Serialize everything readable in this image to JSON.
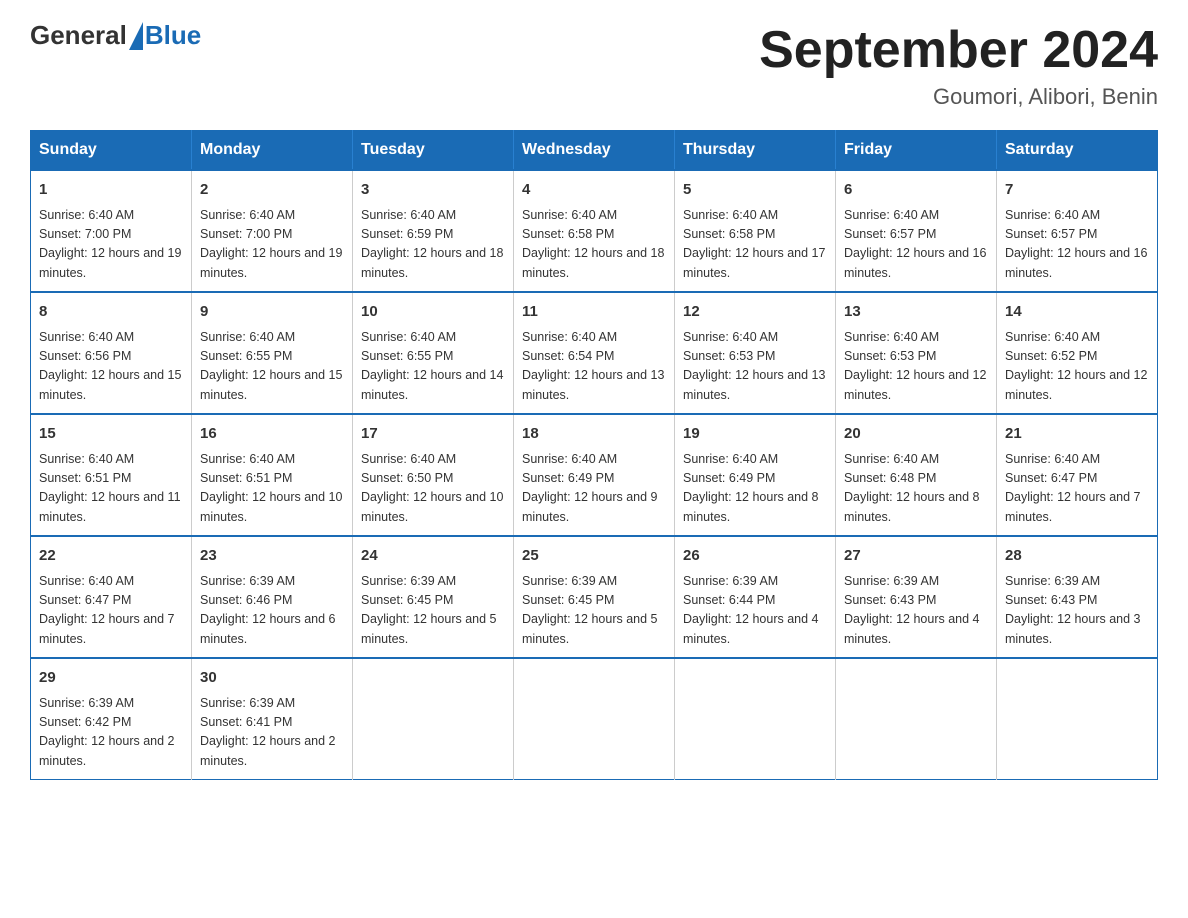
{
  "header": {
    "logo_general": "General",
    "logo_blue": "Blue",
    "main_title": "September 2024",
    "subtitle": "Goumori, Alibori, Benin"
  },
  "calendar": {
    "days_of_week": [
      "Sunday",
      "Monday",
      "Tuesday",
      "Wednesday",
      "Thursday",
      "Friday",
      "Saturday"
    ],
    "weeks": [
      [
        {
          "day": "1",
          "sunrise": "Sunrise: 6:40 AM",
          "sunset": "Sunset: 7:00 PM",
          "daylight": "Daylight: 12 hours and 19 minutes."
        },
        {
          "day": "2",
          "sunrise": "Sunrise: 6:40 AM",
          "sunset": "Sunset: 7:00 PM",
          "daylight": "Daylight: 12 hours and 19 minutes."
        },
        {
          "day": "3",
          "sunrise": "Sunrise: 6:40 AM",
          "sunset": "Sunset: 6:59 PM",
          "daylight": "Daylight: 12 hours and 18 minutes."
        },
        {
          "day": "4",
          "sunrise": "Sunrise: 6:40 AM",
          "sunset": "Sunset: 6:58 PM",
          "daylight": "Daylight: 12 hours and 18 minutes."
        },
        {
          "day": "5",
          "sunrise": "Sunrise: 6:40 AM",
          "sunset": "Sunset: 6:58 PM",
          "daylight": "Daylight: 12 hours and 17 minutes."
        },
        {
          "day": "6",
          "sunrise": "Sunrise: 6:40 AM",
          "sunset": "Sunset: 6:57 PM",
          "daylight": "Daylight: 12 hours and 16 minutes."
        },
        {
          "day": "7",
          "sunrise": "Sunrise: 6:40 AM",
          "sunset": "Sunset: 6:57 PM",
          "daylight": "Daylight: 12 hours and 16 minutes."
        }
      ],
      [
        {
          "day": "8",
          "sunrise": "Sunrise: 6:40 AM",
          "sunset": "Sunset: 6:56 PM",
          "daylight": "Daylight: 12 hours and 15 minutes."
        },
        {
          "day": "9",
          "sunrise": "Sunrise: 6:40 AM",
          "sunset": "Sunset: 6:55 PM",
          "daylight": "Daylight: 12 hours and 15 minutes."
        },
        {
          "day": "10",
          "sunrise": "Sunrise: 6:40 AM",
          "sunset": "Sunset: 6:55 PM",
          "daylight": "Daylight: 12 hours and 14 minutes."
        },
        {
          "day": "11",
          "sunrise": "Sunrise: 6:40 AM",
          "sunset": "Sunset: 6:54 PM",
          "daylight": "Daylight: 12 hours and 13 minutes."
        },
        {
          "day": "12",
          "sunrise": "Sunrise: 6:40 AM",
          "sunset": "Sunset: 6:53 PM",
          "daylight": "Daylight: 12 hours and 13 minutes."
        },
        {
          "day": "13",
          "sunrise": "Sunrise: 6:40 AM",
          "sunset": "Sunset: 6:53 PM",
          "daylight": "Daylight: 12 hours and 12 minutes."
        },
        {
          "day": "14",
          "sunrise": "Sunrise: 6:40 AM",
          "sunset": "Sunset: 6:52 PM",
          "daylight": "Daylight: 12 hours and 12 minutes."
        }
      ],
      [
        {
          "day": "15",
          "sunrise": "Sunrise: 6:40 AM",
          "sunset": "Sunset: 6:51 PM",
          "daylight": "Daylight: 12 hours and 11 minutes."
        },
        {
          "day": "16",
          "sunrise": "Sunrise: 6:40 AM",
          "sunset": "Sunset: 6:51 PM",
          "daylight": "Daylight: 12 hours and 10 minutes."
        },
        {
          "day": "17",
          "sunrise": "Sunrise: 6:40 AM",
          "sunset": "Sunset: 6:50 PM",
          "daylight": "Daylight: 12 hours and 10 minutes."
        },
        {
          "day": "18",
          "sunrise": "Sunrise: 6:40 AM",
          "sunset": "Sunset: 6:49 PM",
          "daylight": "Daylight: 12 hours and 9 minutes."
        },
        {
          "day": "19",
          "sunrise": "Sunrise: 6:40 AM",
          "sunset": "Sunset: 6:49 PM",
          "daylight": "Daylight: 12 hours and 8 minutes."
        },
        {
          "day": "20",
          "sunrise": "Sunrise: 6:40 AM",
          "sunset": "Sunset: 6:48 PM",
          "daylight": "Daylight: 12 hours and 8 minutes."
        },
        {
          "day": "21",
          "sunrise": "Sunrise: 6:40 AM",
          "sunset": "Sunset: 6:47 PM",
          "daylight": "Daylight: 12 hours and 7 minutes."
        }
      ],
      [
        {
          "day": "22",
          "sunrise": "Sunrise: 6:40 AM",
          "sunset": "Sunset: 6:47 PM",
          "daylight": "Daylight: 12 hours and 7 minutes."
        },
        {
          "day": "23",
          "sunrise": "Sunrise: 6:39 AM",
          "sunset": "Sunset: 6:46 PM",
          "daylight": "Daylight: 12 hours and 6 minutes."
        },
        {
          "day": "24",
          "sunrise": "Sunrise: 6:39 AM",
          "sunset": "Sunset: 6:45 PM",
          "daylight": "Daylight: 12 hours and 5 minutes."
        },
        {
          "day": "25",
          "sunrise": "Sunrise: 6:39 AM",
          "sunset": "Sunset: 6:45 PM",
          "daylight": "Daylight: 12 hours and 5 minutes."
        },
        {
          "day": "26",
          "sunrise": "Sunrise: 6:39 AM",
          "sunset": "Sunset: 6:44 PM",
          "daylight": "Daylight: 12 hours and 4 minutes."
        },
        {
          "day": "27",
          "sunrise": "Sunrise: 6:39 AM",
          "sunset": "Sunset: 6:43 PM",
          "daylight": "Daylight: 12 hours and 4 minutes."
        },
        {
          "day": "28",
          "sunrise": "Sunrise: 6:39 AM",
          "sunset": "Sunset: 6:43 PM",
          "daylight": "Daylight: 12 hours and 3 minutes."
        }
      ],
      [
        {
          "day": "29",
          "sunrise": "Sunrise: 6:39 AM",
          "sunset": "Sunset: 6:42 PM",
          "daylight": "Daylight: 12 hours and 2 minutes."
        },
        {
          "day": "30",
          "sunrise": "Sunrise: 6:39 AM",
          "sunset": "Sunset: 6:41 PM",
          "daylight": "Daylight: 12 hours and 2 minutes."
        },
        null,
        null,
        null,
        null,
        null
      ]
    ]
  }
}
